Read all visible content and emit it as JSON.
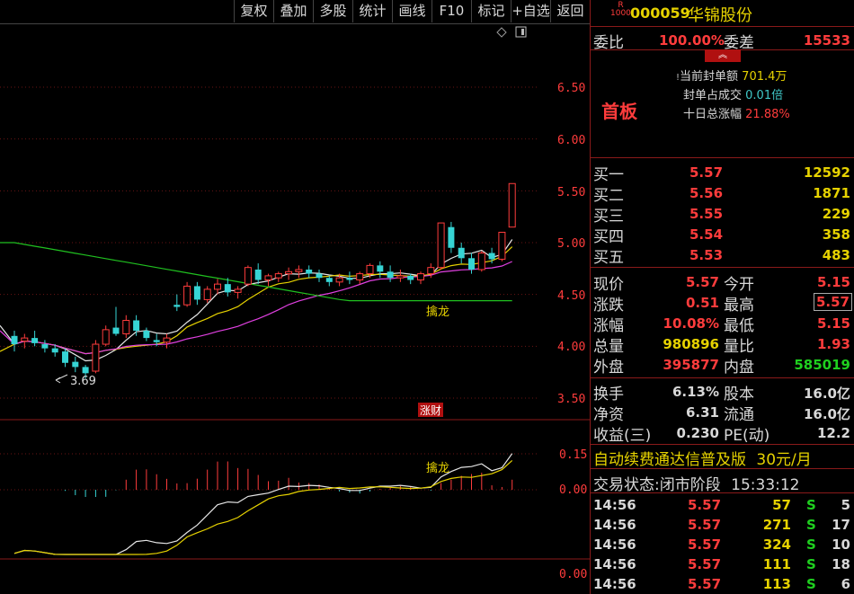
{
  "toolbar": {
    "buttons": [
      "复权",
      "叠加",
      "多股",
      "统计",
      "画线",
      "F10",
      "标记",
      "+自选",
      "返回"
    ]
  },
  "colors": {
    "up": "#ff3c3c",
    "down": "#36d4d4",
    "ma5": "#e6e6e6",
    "ma10": "#e6d200",
    "ma20": "#e040e0",
    "ma60": "#20c020"
  },
  "chart": {
    "price_ticks": [
      "6.50",
      "6.00",
      "5.50",
      "5.00",
      "4.50",
      "4.00",
      "3.50"
    ],
    "min_label": "3.69",
    "badge": "涨财",
    "dragon_label": "擒龙",
    "ind_ticks": [
      "0.15",
      "0.00"
    ],
    "ind_label": "擒龙",
    "bottom_tick": "0.00"
  },
  "chart_data": {
    "type": "candlestick",
    "ylim": [
      3.3,
      6.95
    ],
    "candles": [
      [
        4.1,
        4.15,
        3.95,
        4.02
      ],
      [
        4.05,
        4.12,
        3.98,
        4.08
      ],
      [
        4.08,
        4.15,
        4.0,
        4.03
      ],
      [
        4.02,
        4.06,
        3.94,
        3.98
      ],
      [
        3.98,
        4.02,
        3.9,
        3.94
      ],
      [
        3.95,
        3.98,
        3.8,
        3.84
      ],
      [
        3.85,
        3.9,
        3.75,
        3.8
      ],
      [
        3.8,
        3.82,
        3.69,
        3.74
      ],
      [
        3.76,
        4.06,
        3.74,
        4.02
      ],
      [
        4.02,
        4.2,
        4.0,
        4.16
      ],
      [
        4.18,
        4.38,
        4.1,
        4.12
      ],
      [
        4.12,
        4.3,
        4.08,
        4.25
      ],
      [
        4.25,
        4.3,
        4.1,
        4.15
      ],
      [
        4.15,
        4.18,
        4.05,
        4.08
      ],
      [
        4.06,
        4.12,
        4.0,
        4.04
      ],
      [
        4.04,
        4.12,
        3.98,
        4.08
      ],
      [
        4.4,
        4.5,
        4.34,
        4.38
      ],
      [
        4.4,
        4.62,
        4.38,
        4.58
      ],
      [
        4.58,
        4.62,
        4.4,
        4.45
      ],
      [
        4.45,
        4.58,
        4.42,
        4.55
      ],
      [
        4.55,
        4.65,
        4.5,
        4.6
      ],
      [
        4.6,
        4.66,
        4.48,
        4.52
      ],
      [
        4.52,
        4.58,
        4.46,
        4.55
      ],
      [
        4.6,
        4.78,
        4.58,
        4.76
      ],
      [
        4.74,
        4.8,
        4.6,
        4.64
      ],
      [
        4.64,
        4.7,
        4.58,
        4.68
      ],
      [
        4.66,
        4.72,
        4.62,
        4.7
      ],
      [
        4.7,
        4.76,
        4.64,
        4.72
      ],
      [
        4.72,
        4.78,
        4.66,
        4.74
      ],
      [
        4.74,
        4.78,
        4.66,
        4.7
      ],
      [
        4.7,
        4.74,
        4.62,
        4.66
      ],
      [
        4.66,
        4.68,
        4.58,
        4.62
      ],
      [
        4.62,
        4.7,
        4.58,
        4.66
      ],
      [
        4.66,
        4.72,
        4.6,
        4.64
      ],
      [
        4.64,
        4.72,
        4.6,
        4.7
      ],
      [
        4.7,
        4.8,
        4.66,
        4.78
      ],
      [
        4.78,
        4.82,
        4.66,
        4.72
      ],
      [
        4.72,
        4.78,
        4.62,
        4.66
      ],
      [
        4.66,
        4.74,
        4.62,
        4.68
      ],
      [
        4.68,
        4.7,
        4.6,
        4.64
      ],
      [
        4.64,
        4.72,
        4.6,
        4.7
      ],
      [
        4.7,
        4.8,
        4.66,
        4.76
      ],
      [
        4.76,
        5.19,
        4.74,
        5.19
      ],
      [
        5.15,
        5.2,
        4.9,
        4.95
      ],
      [
        4.95,
        5.0,
        4.8,
        4.85
      ],
      [
        4.85,
        4.9,
        4.7,
        4.74
      ],
      [
        4.74,
        4.92,
        4.72,
        4.9
      ],
      [
        4.9,
        4.95,
        4.8,
        4.84
      ],
      [
        4.84,
        5.1,
        4.82,
        5.1
      ],
      [
        5.15,
        5.57,
        5.15,
        5.57
      ]
    ],
    "ma_start": [
      4.2,
      3.95,
      4.15,
      5.0
    ],
    "ma_end": [
      4.95,
      4.85,
      4.72,
      4.44
    ]
  },
  "stock": {
    "badge_top": "R",
    "badge_bottom": "1000",
    "code": "000059",
    "name": "华锦股份",
    "wei_bi_label": "委比",
    "wei_bi_value": "100.00%",
    "wei_cha_label": "委差",
    "wei_cha_value": "15533",
    "board": "首板",
    "seal_amount_label": "当前封单额",
    "seal_amount_value": "701.4万",
    "seal_ratio_label": "封单占成交",
    "seal_ratio_value": "0.01倍",
    "ten_day_label": "十日总涨幅",
    "ten_day_value": "21.88%"
  },
  "bids": [
    {
      "label": "买一",
      "price": "5.57",
      "vol": "12592"
    },
    {
      "label": "买二",
      "price": "5.56",
      "vol": "1871"
    },
    {
      "label": "买三",
      "price": "5.55",
      "vol": "229"
    },
    {
      "label": "买四",
      "price": "5.54",
      "vol": "358"
    },
    {
      "label": "买五",
      "price": "5.53",
      "vol": "483"
    }
  ],
  "quote": [
    {
      "l1": "现价",
      "v1": "5.57",
      "l2": "今开",
      "v2": "5.15"
    },
    {
      "l1": "涨跌",
      "v1": "0.51",
      "l2": "最高",
      "v2": "5.57"
    },
    {
      "l1": "涨幅",
      "v1": "10.08%",
      "l2": "最低",
      "v2": "5.15"
    },
    {
      "l1": "总量",
      "v1": "980896",
      "l2": "量比",
      "v2": "1.93"
    },
    {
      "l1": "外盘",
      "v1": "395877",
      "l2": "内盘",
      "v2": "585019"
    }
  ],
  "fundamentals": [
    {
      "l1": "换手",
      "v1": "6.13%",
      "l2": "股本",
      "v2": "16.0亿"
    },
    {
      "l1": "净资",
      "v1": "6.31",
      "l2": "流通",
      "v2": "16.0亿"
    },
    {
      "l1": "收益(三)",
      "v1": "0.230",
      "l2": "PE(动)",
      "v2": "12.2"
    }
  ],
  "promo": {
    "text": "自动续费通达信普及版",
    "price": "30元/月"
  },
  "status": {
    "label": "交易状态:",
    "value": "闭市阶段",
    "time": "15:33:12"
  },
  "ticks": [
    {
      "time": "14:56",
      "price": "5.57",
      "vol": "57",
      "side": "S",
      "count": "5"
    },
    {
      "time": "14:56",
      "price": "5.57",
      "vol": "271",
      "side": "S",
      "count": "17"
    },
    {
      "time": "14:56",
      "price": "5.57",
      "vol": "324",
      "side": "S",
      "count": "10"
    },
    {
      "time": "14:56",
      "price": "5.57",
      "vol": "111",
      "side": "S",
      "count": "18"
    },
    {
      "time": "14:56",
      "price": "5.57",
      "vol": "113",
      "side": "S",
      "count": "6"
    }
  ]
}
